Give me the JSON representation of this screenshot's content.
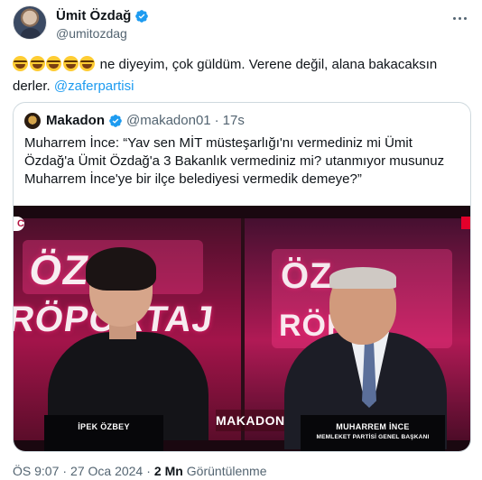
{
  "author": {
    "display_name": "Ümit Özdağ",
    "handle": "@umitozdag",
    "verified_color": "#1d9bf0"
  },
  "tweet": {
    "emoji_count": 5,
    "emoji_name": "face-with-tears-of-joy",
    "text_after_emoji": "ne diyeyim, çok güldüm. Verene değil, alana bakacaksın derler.",
    "mention": "@zaferpartisi"
  },
  "quote": {
    "display_name": "Makadon",
    "handle": "@makadon01",
    "separator": "·",
    "time": "17s",
    "text": "Muharrem İnce:  “Yav sen MİT müsteşarlığı'nı vermediniz mi Ümit Özdağ'a Ümit Özdağ'a  3 Bakanlık vermediniz mi?  utanmıyor musunuz Muharrem İnce'ye bir ilçe belediyesi vermedik demeye?”",
    "media": {
      "bg_left_line1": "ÖZEL",
      "bg_left_line2": "RÖPORTAJ",
      "bg_right_line1": "ÖZ",
      "bg_right_line2": "RÖP",
      "watermark": "MAKADON",
      "left_caption_name": "İPEK ÖZBEY",
      "right_caption_name": "MUHARREM İNCE",
      "right_caption_title": "MEMLEKET PARTİSİ GENEL BAŞKANI",
      "corner_logo": "C"
    }
  },
  "footer": {
    "time": "ÖS 9:07",
    "sep1": "·",
    "date": "27 Oca 2024",
    "sep2": "·",
    "views": "2 Mn",
    "views_label": "Görüntülenme"
  }
}
